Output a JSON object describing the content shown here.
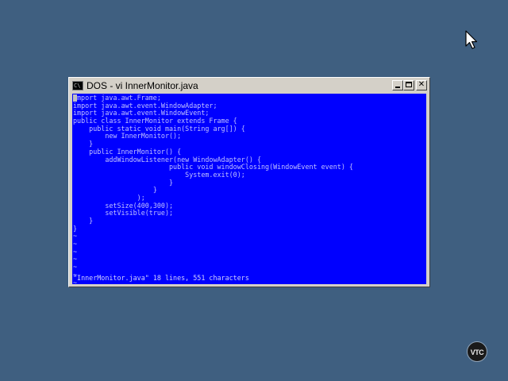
{
  "window": {
    "title": "DOS - vi InnerMonitor.java",
    "icon": "dos-prompt-icon",
    "buttons": {
      "minimize": "minimize-icon",
      "maximize": "maximize-icon",
      "close": "close-icon"
    }
  },
  "editor": {
    "lines": [
      "mport java.awt.Frame;",
      "import java.awt.event.WindowAdapter;",
      "import java.awt.event.WindowEvent;",
      "public class InnerMonitor extends Frame {",
      "    public static void main(String arg[]) {",
      "        new InnerMonitor();",
      "    }",
      "    public InnerMonitor() {",
      "        addWindowListener(new WindowAdapter() {",
      "                        public void windowClosing(WindowEvent event) {",
      "                            System.exit(0);",
      "                        }",
      "                    }",
      "                );",
      "        setSize(400,300);",
      "        setVisible(true);",
      "    }",
      "}",
      "~",
      "~",
      "~",
      "~",
      "~",
      "~",
      "~"
    ],
    "status": "\"InnerMonitor.java\" 18 lines, 551 characters"
  },
  "desktop": {
    "logo_text": "VTC",
    "background_color": "#3f5f80",
    "terminal_color": "#0000ff"
  }
}
